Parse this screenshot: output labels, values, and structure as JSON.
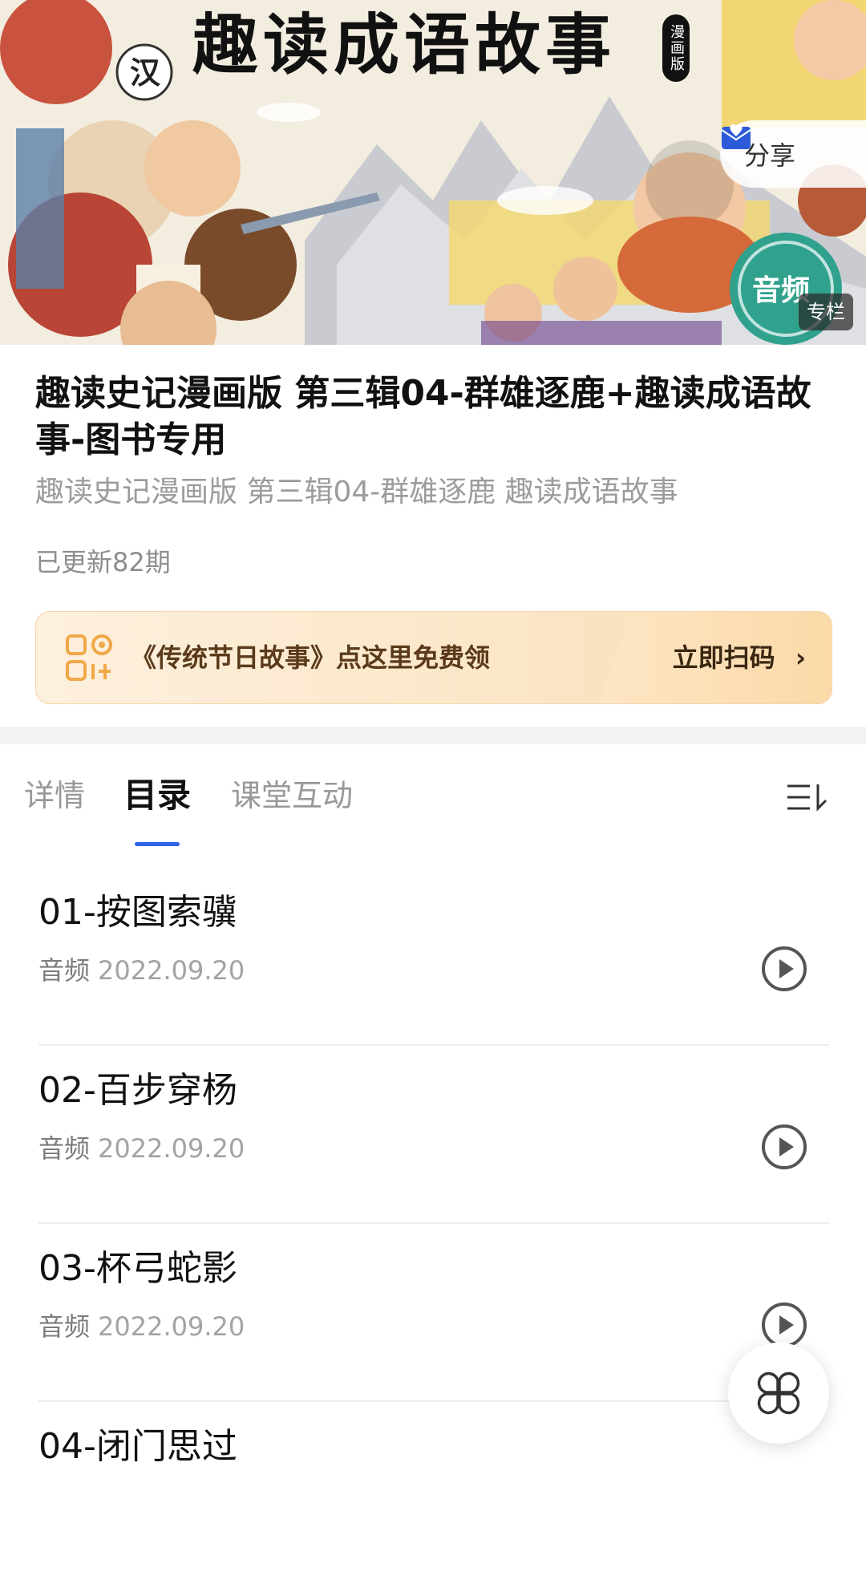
{
  "banner": {
    "title": "趣读成语故事",
    "tag": "漫画版",
    "share_label": "分享",
    "column_badge": "专栏",
    "audio_badge": "音频",
    "scroll_text": "汉"
  },
  "album": {
    "title": "趣读史记漫画版 第三辑04-群雄逐鹿+趣读成语故事-图书专用",
    "subtitle": "趣读史记漫画版 第三辑04-群雄逐鹿 趣读成语故事",
    "update_status": "已更新82期"
  },
  "promo": {
    "text": "《传统节日故事》点这里免费领",
    "action_label": "立即扫码",
    "accent_color": "#f0a848"
  },
  "tabs": [
    {
      "label": "详情",
      "active": false
    },
    {
      "label": "目录",
      "active": true
    },
    {
      "label": "课堂互动",
      "active": false
    }
  ],
  "tab_accent_color": "#2c63e8",
  "episodes": [
    {
      "title": "01-按图索骥",
      "type": "音频",
      "date": "2022.09.20"
    },
    {
      "title": "02-百步穿杨",
      "type": "音频",
      "date": "2022.09.20"
    },
    {
      "title": "03-杯弓蛇影",
      "type": "音频",
      "date": "2022.09.20"
    },
    {
      "title": "04-闭门思过",
      "type": "",
      "date": ""
    }
  ],
  "icons": {
    "share": "envelope-heart-icon",
    "qr": "qr-code-icon",
    "sort": "sort-list-icon",
    "play": "play-circle-icon",
    "fab": "clover-menu-icon"
  }
}
